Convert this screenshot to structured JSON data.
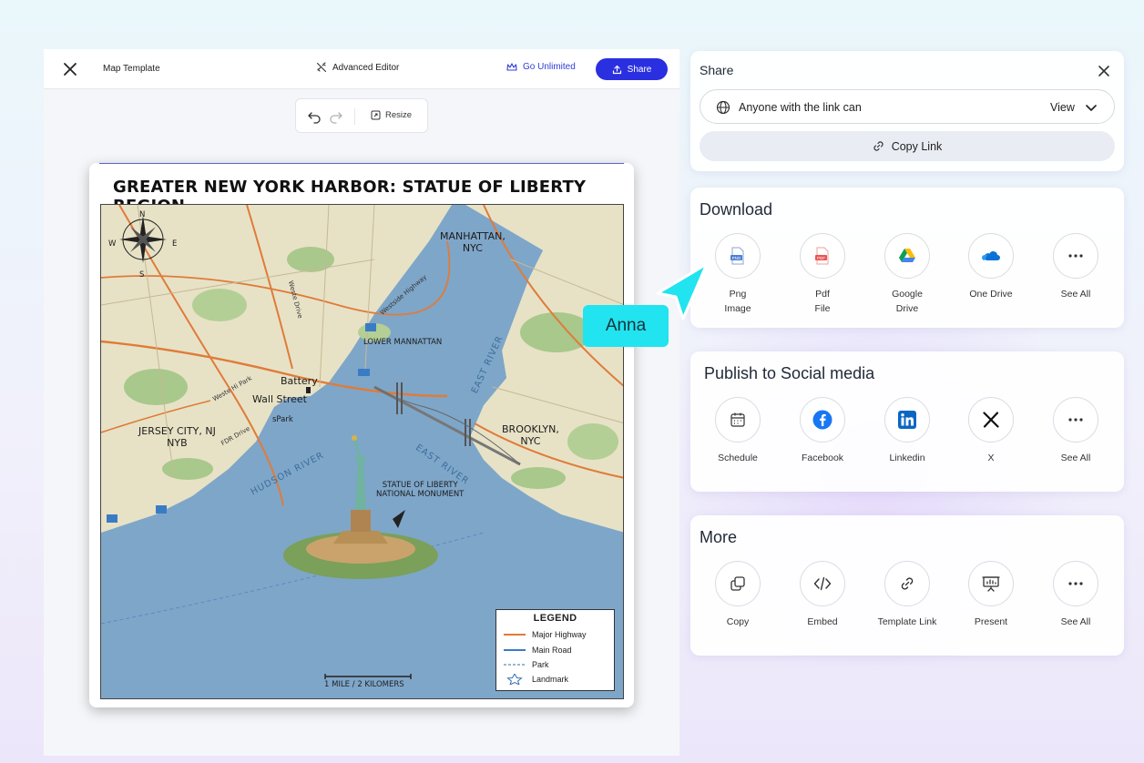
{
  "editor": {
    "doc_title": "Map Template",
    "advanced_editor": "Advanced Editor",
    "go_unlimited": "Go Unlimited",
    "share_label": "Share",
    "resize_label": "Resize"
  },
  "map": {
    "title": "GREATER NEW YORK HARBOR: STATUE OF LIBERTY REGION",
    "compass": {
      "n": "N",
      "s": "S",
      "e": "E",
      "w": "W"
    },
    "labels": {
      "manhattan": "MANHATTAN,\nNYC",
      "lower_manhattan": "LOWER MANNATTAN",
      "battery": "Battery",
      "wall_street": "Wall Street",
      "park": "sPark",
      "jersey_city": "JERSEY CITY, NJ\nNYB",
      "brooklyn": "BROOKLYN,\nNYC",
      "statue": "STATUE OF LIBERTY\nNATIONAL MONUMENT",
      "hudson_river": "HUDSON RIVER",
      "east_river_1": "EAST RIVER",
      "east_river_2": "EAST RIVER",
      "fdr_drive": "FDR Drive",
      "west_hi_park": "Weste Hi Park",
      "west_drive": "Weste Drive",
      "westside_hwy": "Westside Highway"
    },
    "legend": {
      "title": "LEGEND",
      "items": [
        {
          "label": "Major Highway",
          "color": "#e07b39"
        },
        {
          "label": "Main Road",
          "color": "#3a7cc4"
        },
        {
          "label": "Park",
          "color": "#5a8bbf"
        },
        {
          "label": "Landmark",
          "color": "#3a6fb0"
        }
      ]
    },
    "scale": "1 MILE / 2 KILOMERS"
  },
  "share": {
    "title": "Share",
    "access_text": "Anyone with the link can",
    "access_level": "View",
    "copy_link": "Copy Link"
  },
  "download": {
    "title": "Download",
    "items": [
      {
        "label": "Png\nImage",
        "icon": "png-file-icon"
      },
      {
        "label": "Pdf\nFile",
        "icon": "pdf-file-icon"
      },
      {
        "label": "Google\nDrive",
        "icon": "google-drive-icon"
      },
      {
        "label": "One Drive",
        "icon": "onedrive-icon"
      },
      {
        "label": "See All",
        "icon": "more-dots-icon"
      }
    ]
  },
  "social": {
    "title": "Publish to Social media",
    "items": [
      {
        "label": "Schedule",
        "icon": "calendar-icon"
      },
      {
        "label": "Facebook",
        "icon": "facebook-icon"
      },
      {
        "label": "Linkedin",
        "icon": "linkedin-icon"
      },
      {
        "label": "X",
        "icon": "x-logo-icon"
      },
      {
        "label": "See All",
        "icon": "more-dots-icon"
      }
    ]
  },
  "more": {
    "title": "More",
    "items": [
      {
        "label": "Copy",
        "icon": "copy-icon"
      },
      {
        "label": "Embed",
        "icon": "code-icon"
      },
      {
        "label": "Template Link",
        "icon": "link-icon"
      },
      {
        "label": "Present",
        "icon": "presentation-icon"
      },
      {
        "label": "See All",
        "icon": "more-dots-icon"
      }
    ]
  },
  "collaborator": {
    "name": "Anna",
    "color": "#22e3f0"
  }
}
